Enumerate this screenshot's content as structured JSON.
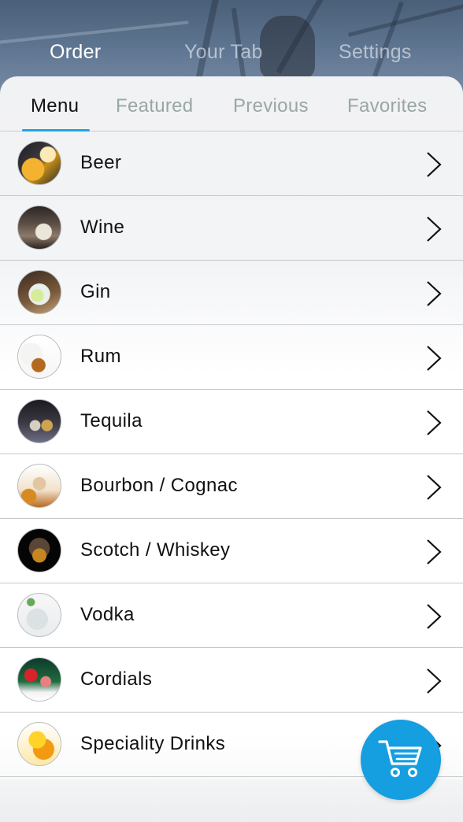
{
  "top_tabs": [
    {
      "label": "Order",
      "active": true
    },
    {
      "label": "Your Tab",
      "active": false
    },
    {
      "label": "Settings",
      "active": false
    }
  ],
  "sub_tabs": [
    {
      "label": "Menu",
      "active": true
    },
    {
      "label": "Featured",
      "active": false
    },
    {
      "label": "Previous",
      "active": false
    },
    {
      "label": "Favorites",
      "active": false
    }
  ],
  "menu": {
    "items": [
      {
        "label": "Beer",
        "icon": "beer-thumbnail"
      },
      {
        "label": "Wine",
        "icon": "wine-thumbnail"
      },
      {
        "label": "Gin",
        "icon": "gin-thumbnail"
      },
      {
        "label": "Rum",
        "icon": "rum-thumbnail"
      },
      {
        "label": "Tequila",
        "icon": "tequila-thumbnail"
      },
      {
        "label": "Bourbon / Cognac",
        "icon": "bourbon-thumbnail"
      },
      {
        "label": "Scotch / Whiskey",
        "icon": "scotch-thumbnail"
      },
      {
        "label": "Vodka",
        "icon": "vodka-thumbnail"
      },
      {
        "label": "Cordials",
        "icon": "cordials-thumbnail"
      },
      {
        "label": "Speciality Drinks",
        "icon": "speciality-thumbnail"
      }
    ]
  },
  "cart": {
    "icon": "cart-icon"
  },
  "colors": {
    "accent": "#1aa6e4",
    "cart_button": "#159ee0",
    "inactive_tab": "#9aa6a6",
    "text": "#111111"
  }
}
